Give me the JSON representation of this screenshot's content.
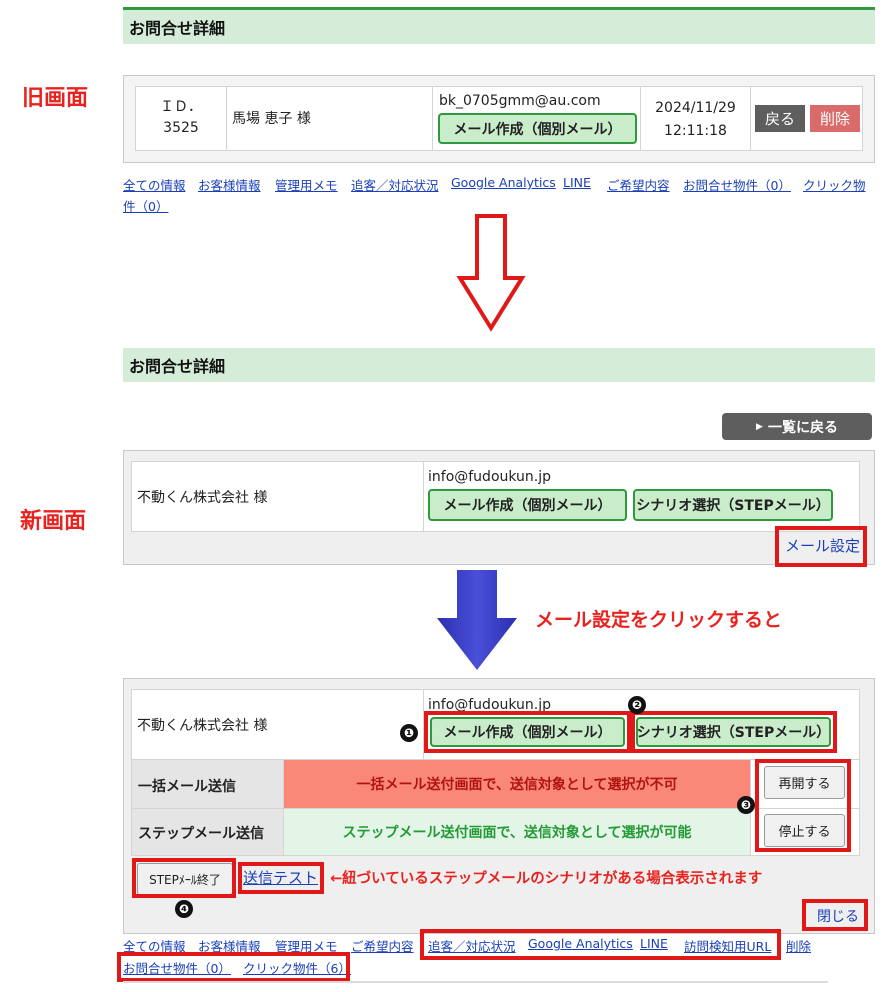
{
  "old": {
    "header": "お問合せ詳細",
    "label": "旧画面",
    "id_label": "ＩＤ．",
    "id_value": "3525",
    "name": "馬場 恵子 様",
    "email": "bk_0705gmm@au.com",
    "mail_btn": "メール作成（個別メール）",
    "date": "2024/11/29",
    "time": "12:11:18",
    "back_btn": "戻る",
    "delete_btn": "削除",
    "tabs": [
      "全ての情報",
      "お客様情報",
      "管理用メモ",
      "追客／対応状況",
      "Google Analytics",
      "LINE",
      "ご希望内容",
      "お問合せ物件（0）",
      "クリック物",
      "件（0）"
    ]
  },
  "new": {
    "header": "お問合せ詳細",
    "label": "新画面",
    "list_back_btn": "一覧に戻る",
    "name": "不動くん株式会社 様",
    "email": "info@fudoukun.jp",
    "mail_btn": "メール作成（個別メール）",
    "scenario_btn": "シナリオ選択（STEPメール）",
    "mail_settings_link": "メール設定",
    "annotation": "メール設定をクリックすると",
    "expanded": {
      "name": "不動くん株式会社 様",
      "email": "info@fudoukun.jp",
      "mail_btn": "メール作成（個別メール）",
      "scenario_btn": "シナリオ選択（STEPメール）",
      "bulk_label": "一括メール送信",
      "bulk_status": "一括メール送付画面で、送信対象として選択が不可",
      "resume_btn": "再開する",
      "step_label": "ステップメール送信",
      "step_status": "ステップメール送付画面で、送信対象として選択が可能",
      "stop_btn": "停止する",
      "step_end_btn": "STEPﾒｰﾙ終了",
      "send_test_link": "送信テスト",
      "note": "←紐づいているステップメールのシナリオがある場合表示されます",
      "close_link": "閉じる",
      "n1": "❶",
      "n2": "❷",
      "n3": "❸",
      "n4": "❹"
    },
    "tabs": [
      "全ての情報",
      "お客様情報",
      "管理用メモ",
      "ご希望内容",
      "追客／対応状況",
      "Google Analytics",
      "LINE",
      "訪問検知用URL",
      "削除",
      "お問合せ物件（0）",
      "クリック物件（6）"
    ]
  },
  "colors": {
    "header_bg": "#d4ecd8",
    "green_btn": "#c9eccb",
    "red_status": "#f98878",
    "green_status": "#e3f5e6",
    "accent_red": "#e01818",
    "arrow_blue": "#3b3fc9"
  }
}
